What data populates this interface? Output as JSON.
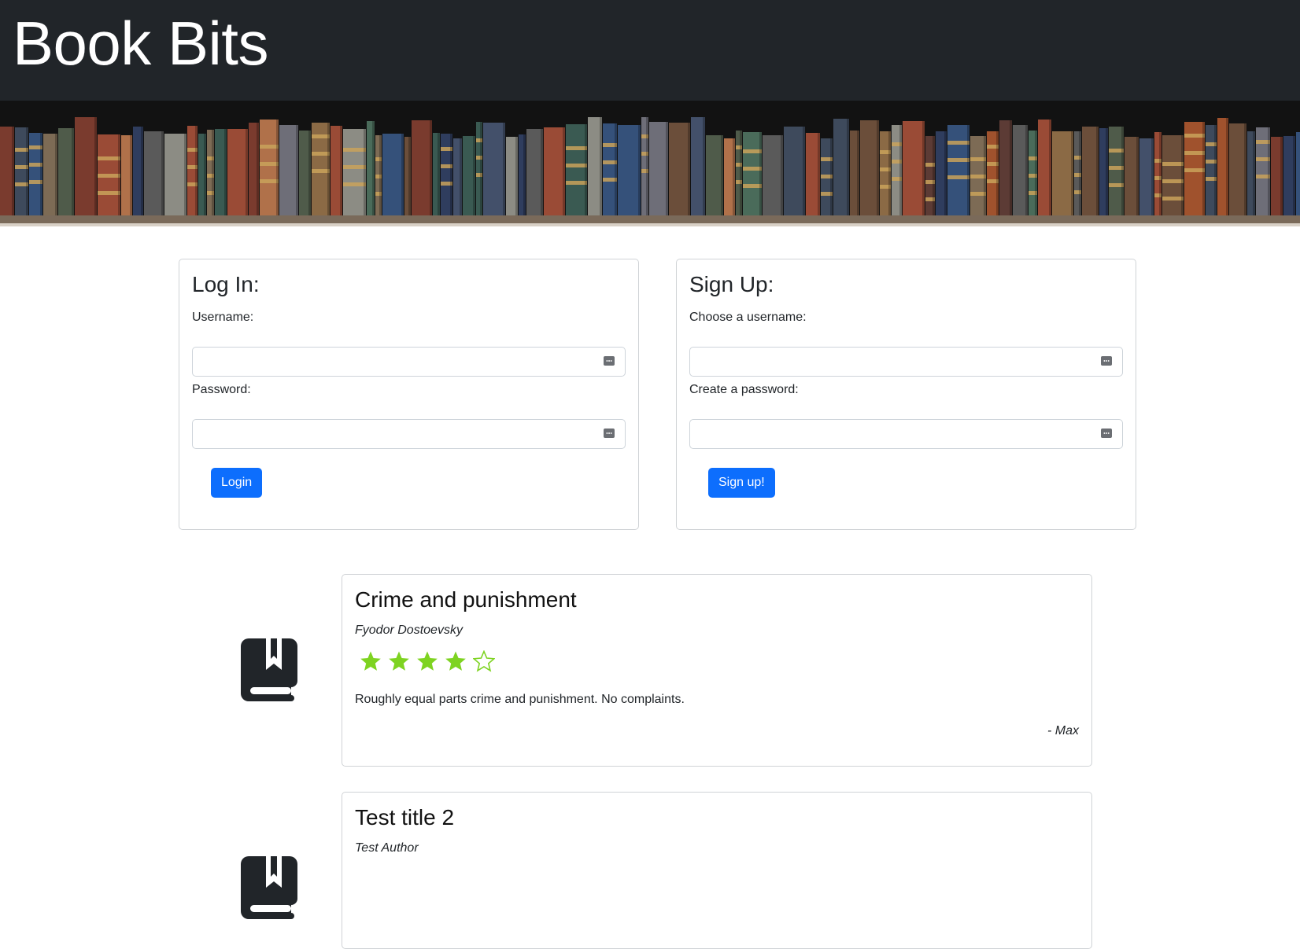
{
  "site": {
    "title": "Book Bits"
  },
  "login": {
    "heading": "Log In:",
    "username_label": "Username:",
    "password_label": "Password:",
    "button": "Login"
  },
  "signup": {
    "heading": "Sign Up:",
    "username_label": "Choose a username:",
    "password_label": "Create a password:",
    "button": "Sign up!"
  },
  "reviews": [
    {
      "title": "Crime and punishment",
      "author": "Fyodor Dostoevsky",
      "rating": 4,
      "rating_max": 5,
      "text": "Roughly equal parts crime and punishment. No complaints.",
      "reviewer": "- Max"
    },
    {
      "title": "Test title 2",
      "author": "Test Author"
    }
  ],
  "colors": {
    "header_bg": "#212529",
    "button_bg": "#0d6efd",
    "star": "#7ed321",
    "icon": "#212529"
  },
  "icons": {
    "book": "book-bookmark-icon",
    "star_filled": "star-filled-icon",
    "star_empty": "star-outline-icon",
    "field_key": "password-manager-key-icon"
  }
}
